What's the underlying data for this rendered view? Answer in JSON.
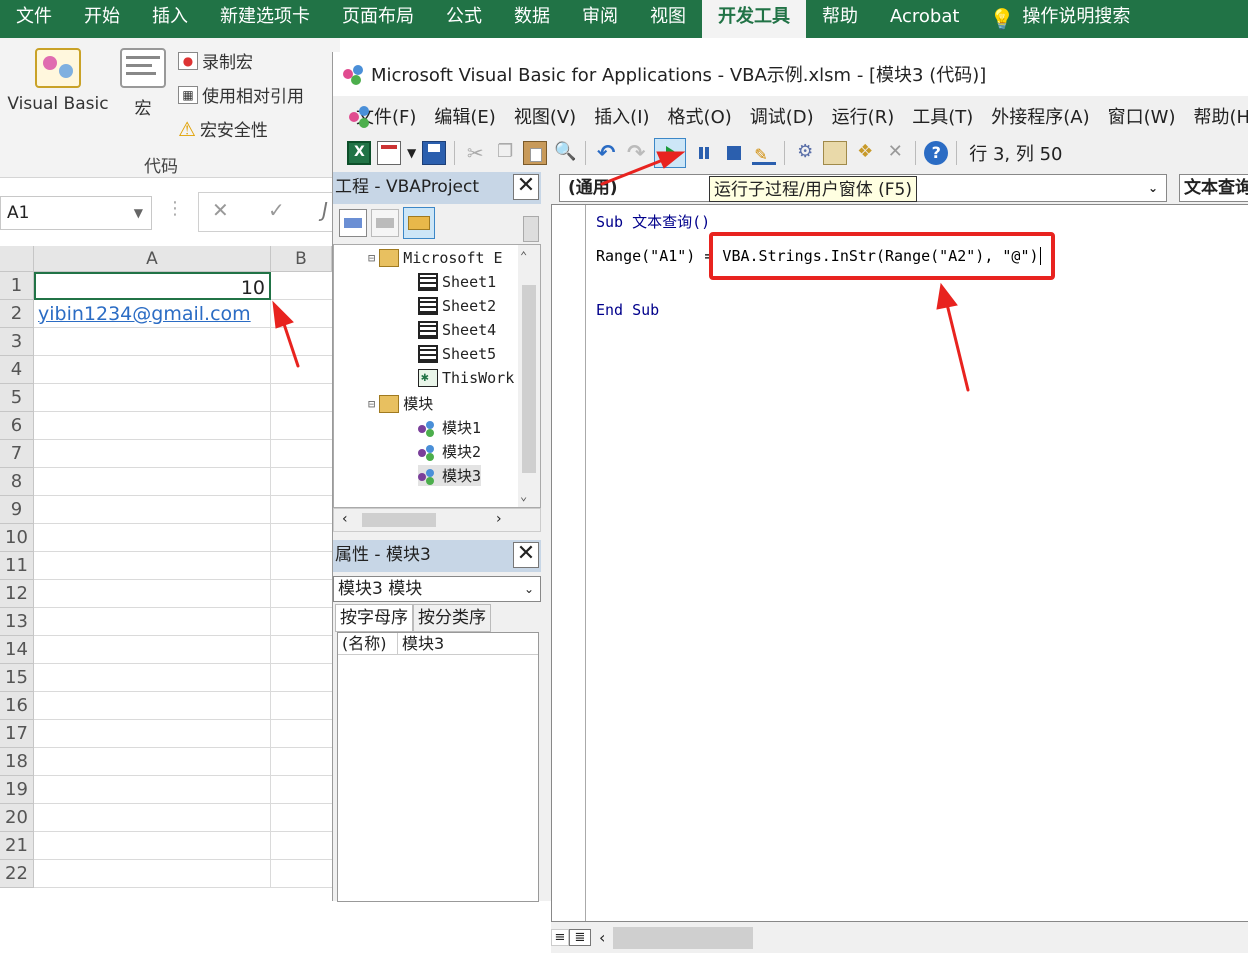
{
  "excel": {
    "tabs": [
      "文件",
      "开始",
      "插入",
      "新建选项卡",
      "页面布局",
      "公式",
      "数据",
      "审阅",
      "视图",
      "开发工具",
      "帮助",
      "Acrobat",
      "操作说明搜索"
    ],
    "active_tab": "开发工具",
    "ribbon": {
      "visual_basic": "Visual Basic",
      "macro": "宏",
      "record_macro": "录制宏",
      "relative_ref": "使用相对引用",
      "macro_security": "宏安全性",
      "group_code": "代码"
    },
    "namebox": "A1",
    "fx_cancel": "✕",
    "fx_enter": "✓",
    "fx_label": "J",
    "columns": [
      "A",
      "B"
    ],
    "rows": [
      "1",
      "2",
      "3",
      "4",
      "5",
      "6",
      "7",
      "8",
      "9",
      "10",
      "11",
      "12",
      "13",
      "14",
      "15",
      "16",
      "17",
      "18",
      "19",
      "20",
      "21",
      "22"
    ],
    "cells": {
      "A1": "10",
      "A2": "yibin1234@gmail.com"
    }
  },
  "vbe": {
    "title": "Microsoft Visual Basic for Applications - VBA示例.xlsm - [模块3 (代码)]",
    "menu": [
      "文件(F)",
      "编辑(E)",
      "视图(V)",
      "插入(I)",
      "格式(O)",
      "调试(D)",
      "运行(R)",
      "工具(T)",
      "外接程序(A)",
      "窗口(W)",
      "帮助(H)"
    ],
    "position": "行 3, 列 50",
    "tooltip": "运行子过程/用户窗体 (F5)",
    "project": {
      "header": "工程 - VBAProject",
      "nodes": [
        "Microsoft E",
        "Sheet1",
        "Sheet2",
        "Sheet4",
        "Sheet5",
        "ThisWork",
        "模块",
        "模块1",
        "模块2",
        "模块3"
      ]
    },
    "properties": {
      "header": "属性 - 模块3",
      "selected": "模块3 模块",
      "tab_alpha": "按字母序",
      "tab_category": "按分类序",
      "row_name": "(名称)",
      "row_value": "模块3"
    },
    "code": {
      "combo_object": "(通用)",
      "combo_proc": "文本查询",
      "line1": "Sub 文本查询()",
      "line2": "Range(\"A1\") = VBA.Strings.InStr(Range(\"A2\"), \"@\")",
      "line3": "End Sub"
    }
  },
  "colors": {
    "excel_green": "#217346",
    "annotation_red": "#e8231f",
    "tooltip_bg": "#ffffe1"
  }
}
